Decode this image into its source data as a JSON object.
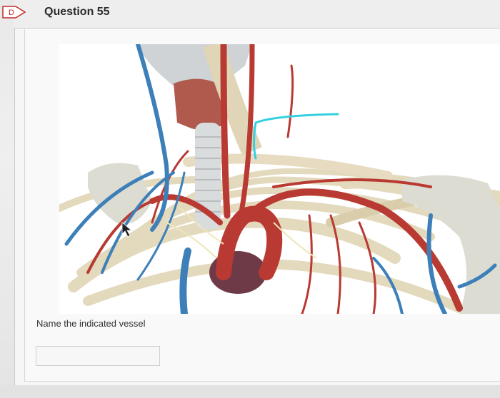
{
  "question": {
    "title": "Question 55",
    "prompt": "Name the indicated vessel"
  },
  "answer": {
    "value": "",
    "placeholder": ""
  },
  "figure": {
    "subject": "anatomy-thorax-neck-vessels"
  },
  "colors": {
    "artery": "#b83a33",
    "vein": "#3d7fb8",
    "indicator": "#33d0e0",
    "bone": "#e8dfc7"
  }
}
